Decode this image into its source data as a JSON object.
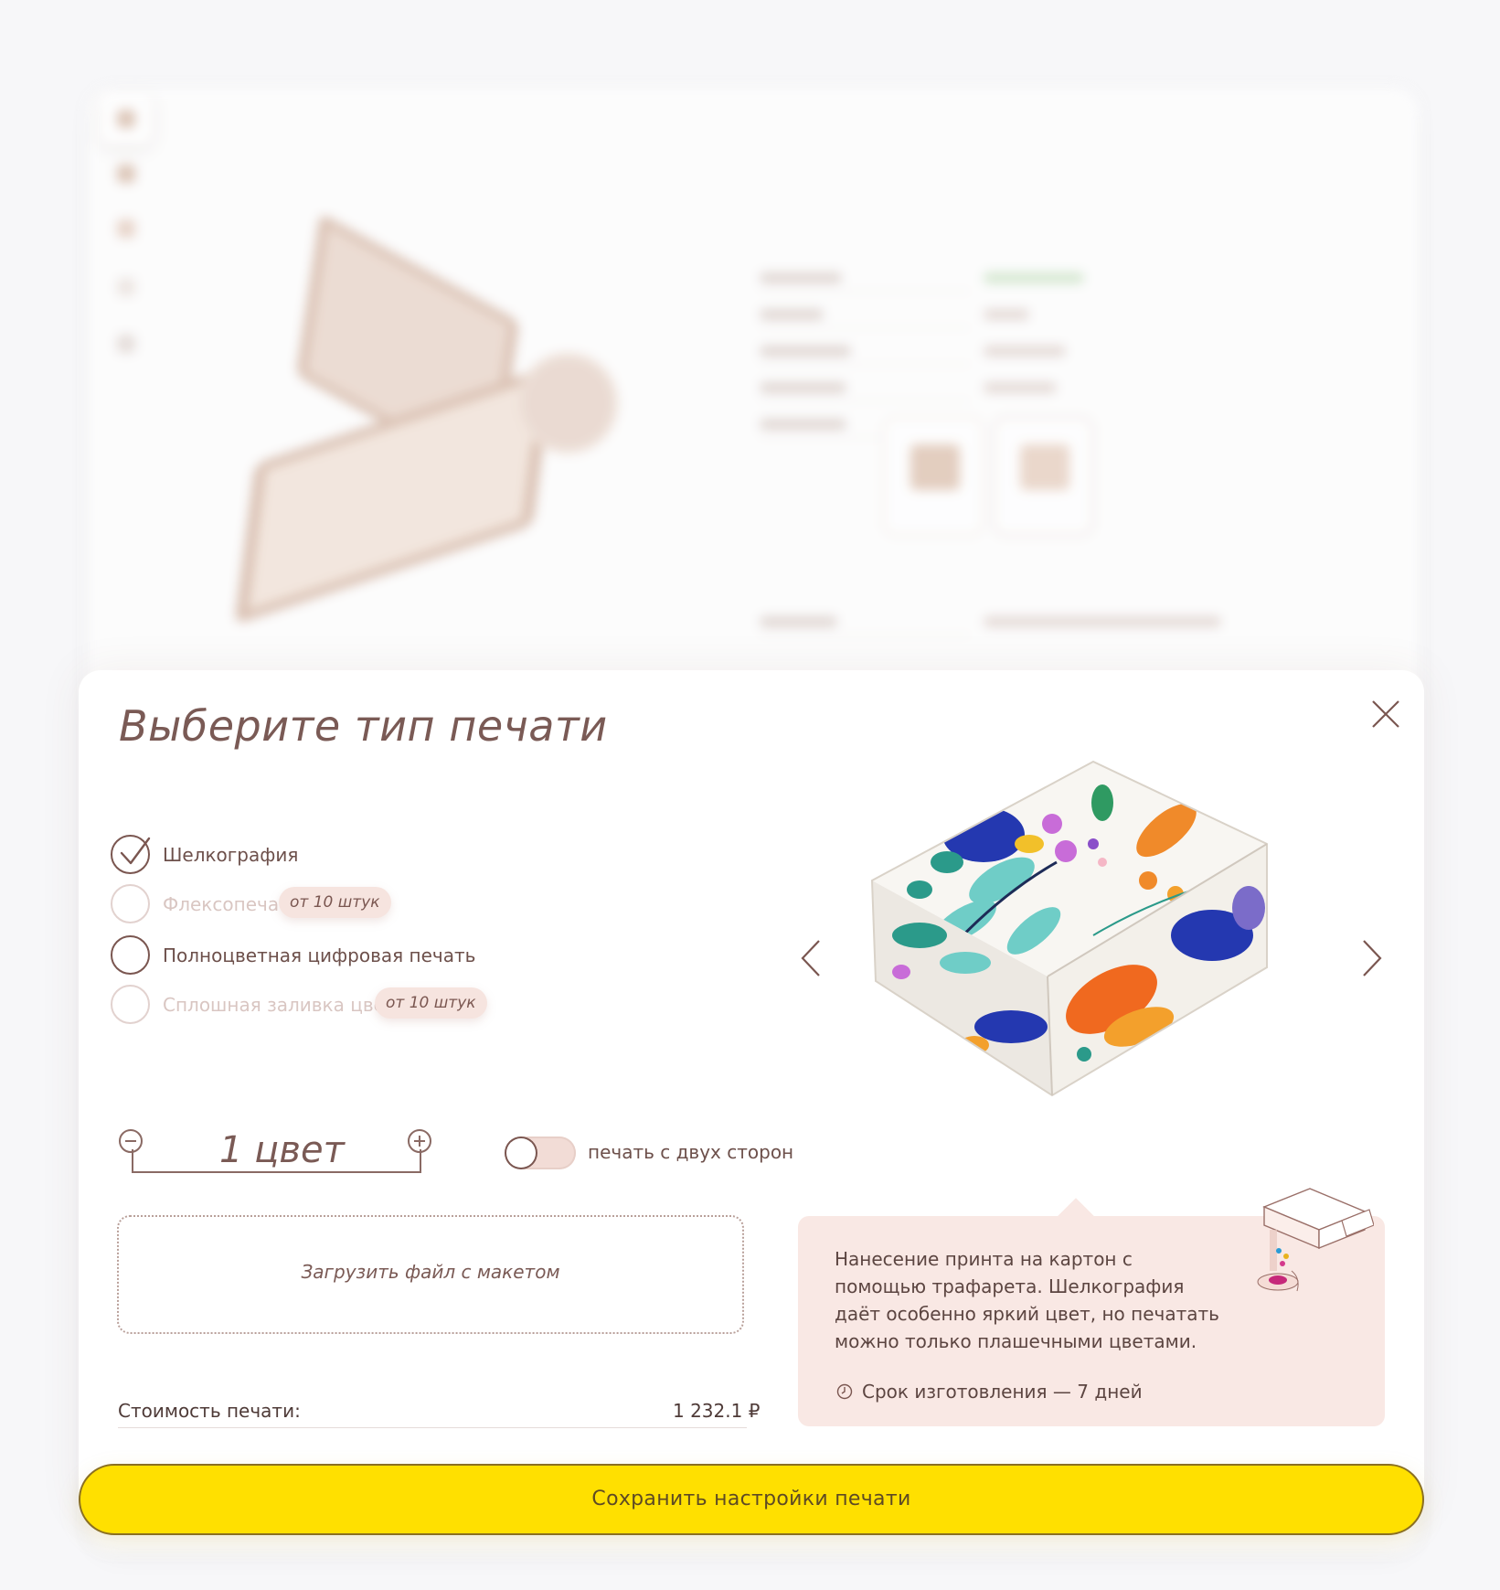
{
  "modal": {
    "title": "Выберите тип печати",
    "options": [
      {
        "label": "Шелкография",
        "selected": true,
        "disabled": false,
        "badge": ""
      },
      {
        "label": "Флексопечать",
        "selected": false,
        "disabled": true,
        "badge": "от 10 штук"
      },
      {
        "label": "Полноцветная цифровая печать",
        "selected": false,
        "disabled": false,
        "badge": ""
      },
      {
        "label": "Сплошная заливка цветом",
        "selected": false,
        "disabled": true,
        "badge": "от 10 штук"
      }
    ],
    "counter": {
      "value": "1 цвет"
    },
    "toggle": {
      "label": "печать с двух сторон",
      "on": false
    },
    "upload_label": "Загрузить файл с макетом",
    "cost": {
      "label": "Стоимость печати:",
      "value": "1 232.1 ₽"
    },
    "info": {
      "text": "Нанесение принта на картон с помощью трафарета. Шелкография даёт особенно яркий цвет, но печатать можно только плашечными цветами.",
      "term": "Срок изготовления — 7 дней"
    },
    "save_label": "Сохранить настройки печати"
  },
  "colors": {
    "accent": "#ffe000",
    "text": "#6e4f4a",
    "info_bg": "#f9e8e4",
    "badge_bg": "#f6e4df"
  },
  "icons": [
    "close-icon",
    "check-icon",
    "minus-icon",
    "plus-icon",
    "chevron-left-icon",
    "chevron-right-icon",
    "clock-icon",
    "printer-illustration"
  ]
}
